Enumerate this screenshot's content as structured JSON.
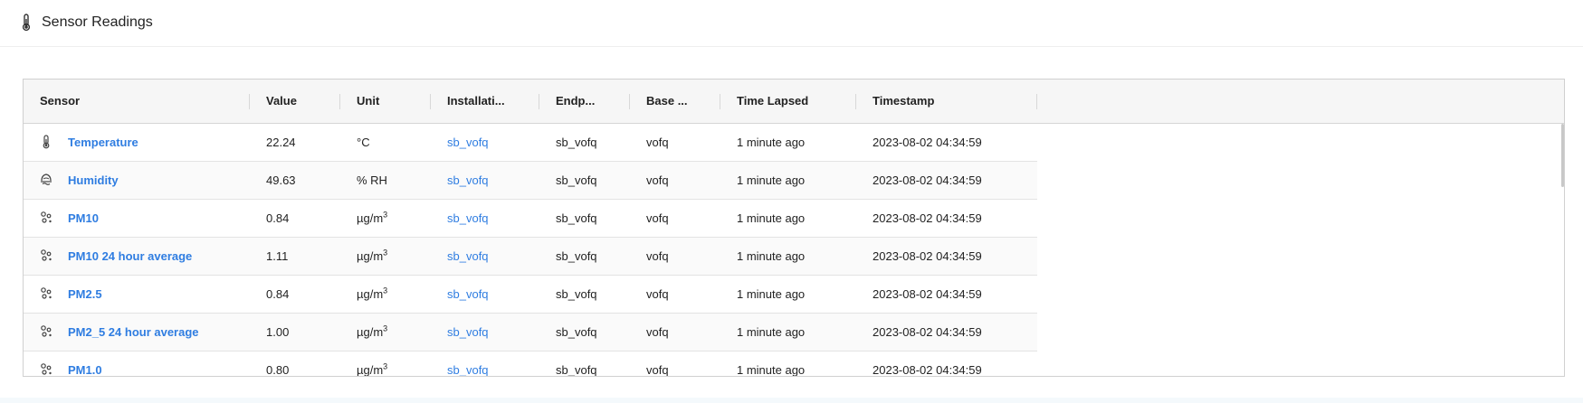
{
  "header": {
    "icon": "thermometer-icon",
    "title": "Sensor Readings"
  },
  "table": {
    "columns": [
      "Sensor",
      "Value",
      "Unit",
      "Installati...",
      "Endp...",
      "Base ...",
      "Time Lapsed",
      "Timestamp"
    ],
    "rows": [
      {
        "icon": "thermometer-icon",
        "sensor": "Temperature",
        "value": "22.24",
        "unit": "°C",
        "unit_sup": "",
        "installation": "sb_vofq",
        "endpoint": "sb_vofq",
        "base": "vofq",
        "time_lapsed": "1 minute ago",
        "timestamp": "2023-08-02 04:34:59"
      },
      {
        "icon": "humidity-icon",
        "sensor": "Humidity",
        "value": "49.63",
        "unit": "% RH",
        "unit_sup": "",
        "installation": "sb_vofq",
        "endpoint": "sb_vofq",
        "base": "vofq",
        "time_lapsed": "1 minute ago",
        "timestamp": "2023-08-02 04:34:59"
      },
      {
        "icon": "particles-icon",
        "sensor": "PM10",
        "value": "0.84",
        "unit": "µg/m",
        "unit_sup": "3",
        "installation": "sb_vofq",
        "endpoint": "sb_vofq",
        "base": "vofq",
        "time_lapsed": "1 minute ago",
        "timestamp": "2023-08-02 04:34:59"
      },
      {
        "icon": "particles-icon",
        "sensor": "PM10 24 hour average",
        "value": "1.11",
        "unit": "µg/m",
        "unit_sup": "3",
        "installation": "sb_vofq",
        "endpoint": "sb_vofq",
        "base": "vofq",
        "time_lapsed": "1 minute ago",
        "timestamp": "2023-08-02 04:34:59"
      },
      {
        "icon": "particles-icon",
        "sensor": "PM2.5",
        "value": "0.84",
        "unit": "µg/m",
        "unit_sup": "3",
        "installation": "sb_vofq",
        "endpoint": "sb_vofq",
        "base": "vofq",
        "time_lapsed": "1 minute ago",
        "timestamp": "2023-08-02 04:34:59"
      },
      {
        "icon": "particles-icon",
        "sensor": "PM2_5 24 hour average",
        "value": "1.00",
        "unit": "µg/m",
        "unit_sup": "3",
        "installation": "sb_vofq",
        "endpoint": "sb_vofq",
        "base": "vofq",
        "time_lapsed": "1 minute ago",
        "timestamp": "2023-08-02 04:34:59"
      },
      {
        "icon": "particles-icon",
        "sensor": "PM1.0",
        "value": "0.80",
        "unit": "µg/m",
        "unit_sup": "3",
        "installation": "sb_vofq",
        "endpoint": "sb_vofq",
        "base": "vofq",
        "time_lapsed": "1 minute ago",
        "timestamp": "2023-08-02 04:34:59"
      }
    ]
  },
  "colors": {
    "link": "#2f7de1",
    "header_bg": "#f6f6f6",
    "border": "#d0d0d0"
  }
}
